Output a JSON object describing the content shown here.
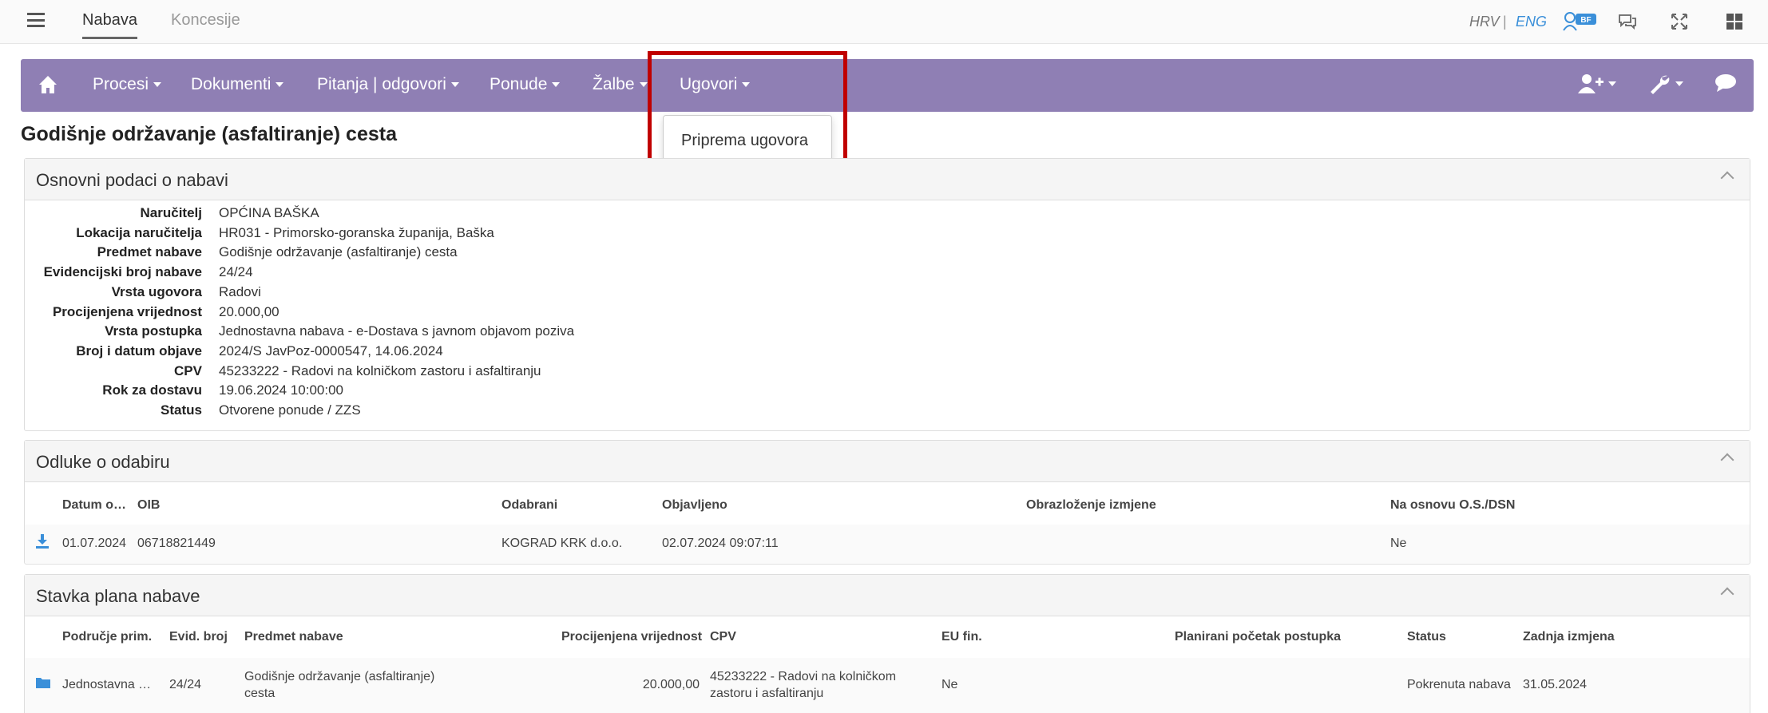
{
  "topbar": {
    "tabs": [
      "Nabava",
      "Koncesije"
    ],
    "lang_hrv": "HRV",
    "lang_sep": "|",
    "lang_eng": "ENG",
    "user_badge": "BF",
    "icons": [
      "hamburger-icon",
      "user-badge-icon",
      "chat-bubbles-icon",
      "fullscreen-icon",
      "grid-icon"
    ]
  },
  "navbar": {
    "items": [
      "Procesi",
      "Dokumenti",
      "Pitanja | odgovori",
      "Ponude",
      "Žalbe",
      "Ugovori"
    ],
    "color": "#8f7fb4",
    "icons": [
      "home-icon",
      "add-user-icon",
      "wrench-icon",
      "comment-icon"
    ]
  },
  "dropdown": {
    "items": [
      "Priprema ugovora"
    ]
  },
  "page_title": "Godišnje održavanje (asfaltiranje) cesta",
  "panels": {
    "basic": {
      "title": "Osnovni podaci o nabavi",
      "rows": [
        {
          "label": "Naručitelj",
          "value": "OPĆINA BAŠKA"
        },
        {
          "label": "Lokacija naručitelja",
          "value": "HR031 - Primorsko-goranska županija, Baška"
        },
        {
          "label": "Predmet nabave",
          "value": "Godišnje održavanje (asfaltiranje) cesta"
        },
        {
          "label": "Evidencijski broj nabave",
          "value": "24/24"
        },
        {
          "label": "Vrsta ugovora",
          "value": "Radovi"
        },
        {
          "label": "Procijenjena vrijednost",
          "value": "20.000,00"
        },
        {
          "label": "Vrsta postupka",
          "value": "Jednostavna nabava - e-Dostava s javnom objavom poziva"
        },
        {
          "label": "Broj i datum objave",
          "value": "2024/S JavPoz-0000547, 14.06.2024"
        },
        {
          "label": "CPV",
          "value": "45233222 - Radovi na kolničkom zastoru i asfaltiranju"
        },
        {
          "label": "Rok za dostavu",
          "value": "19.06.2024 10:00:00"
        },
        {
          "label": "Status",
          "value": "Otvorene ponude / ZZS"
        }
      ]
    },
    "decisions": {
      "title": "Odluke o odabiru",
      "headers": [
        "Datum o…",
        "OIB",
        "Odabrani",
        "Objavljeno",
        "Obrazloženje izmjene",
        "Na osnovu O.S./DSN"
      ],
      "row": {
        "datum": "01.07.2024",
        "oib": "06718821449",
        "odabrani": "KOGRAD KRK d.o.o.",
        "objavljeno": "02.07.2024 09:07:11",
        "obrazlozenje": "",
        "osnova": "Ne"
      }
    },
    "plan": {
      "title": "Stavka plana nabave",
      "headers": [
        "Područje prim.",
        "Evid. broj",
        "Predmet nabave",
        "Procijenjena vrijednost",
        "CPV",
        "EU fin.",
        "Planirani početak postupka",
        "Status",
        "Zadnja izmjena"
      ],
      "row": {
        "podrucje": "Jednostavna …",
        "evid": "24/24",
        "predmet": "Godišnje održavanje (asfaltiranje) cesta",
        "vrijednost": "20.000,00",
        "cpv": "45233222 - Radovi na kolničkom zastoru i asfaltiranju",
        "eu": "Ne",
        "pocetak": "",
        "status": "Pokrenuta nabava",
        "izmjena": "31.05.2024"
      }
    }
  }
}
